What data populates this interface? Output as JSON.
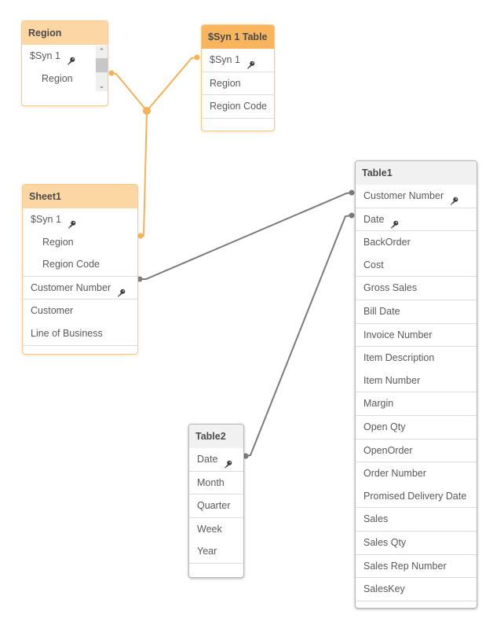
{
  "colors": {
    "synthetic_link": "#f6b154",
    "link": "#7a7a7a",
    "header_light_orange": "#fdd7a3",
    "header_orange": "#f8b55e",
    "header_gray": "#f1f1f1"
  },
  "tables": {
    "region": {
      "title": "Region",
      "groups": [
        [
          {
            "label": "$Syn 1",
            "key": true
          },
          {
            "label": "Region",
            "indent": true
          }
        ]
      ],
      "scrollbar": {
        "up_icon": "chevron-up-icon",
        "down_icon": "chevron-down-icon"
      }
    },
    "syn1table": {
      "title": "$Syn 1 Table",
      "groups": [
        [
          {
            "label": "$Syn 1",
            "key": true
          }
        ],
        [
          {
            "label": "Region"
          }
        ],
        [
          {
            "label": "Region Code"
          }
        ]
      ]
    },
    "sheet1": {
      "title": "Sheet1",
      "groups": [
        [
          {
            "label": "$Syn 1",
            "key": true
          },
          {
            "label": "Region",
            "indent": true
          },
          {
            "label": "Region Code",
            "indent": true
          }
        ],
        [
          {
            "label": "Customer Number",
            "key": true
          }
        ],
        [
          {
            "label": "Customer"
          },
          {
            "label": "Line of Business"
          }
        ]
      ]
    },
    "table1": {
      "title": "Table1",
      "groups": [
        [
          {
            "label": "Customer Number",
            "key": true
          }
        ],
        [
          {
            "label": "Date",
            "key": true
          }
        ],
        [
          {
            "label": "BackOrder"
          },
          {
            "label": "Cost"
          }
        ],
        [
          {
            "label": "Gross Sales"
          }
        ],
        [
          {
            "label": "Bill Date"
          }
        ],
        [
          {
            "label": "Invoice Number"
          }
        ],
        [
          {
            "label": "Item Description"
          },
          {
            "label": "Item Number"
          }
        ],
        [
          {
            "label": "Margin"
          }
        ],
        [
          {
            "label": "Open Qty"
          }
        ],
        [
          {
            "label": "OpenOrder"
          }
        ],
        [
          {
            "label": "Order Number"
          },
          {
            "label": "Promised Delivery Date"
          }
        ],
        [
          {
            "label": "Sales"
          }
        ],
        [
          {
            "label": "Sales Qty"
          }
        ],
        [
          {
            "label": "Sales Rep Number"
          }
        ],
        [
          {
            "label": "SalesKey"
          }
        ]
      ]
    },
    "table2": {
      "title": "Table2",
      "groups": [
        [
          {
            "label": "Date",
            "key": true
          }
        ],
        [
          {
            "label": "Month"
          }
        ],
        [
          {
            "label": "Quarter"
          }
        ],
        [
          {
            "label": "Week"
          },
          {
            "label": "Year"
          }
        ]
      ]
    }
  },
  "links": [
    {
      "kind": "synthetic",
      "from": "Region.$Syn 1",
      "to": "$Syn 1 Table.$Syn 1"
    },
    {
      "kind": "synthetic",
      "from": "Sheet1.$Syn 1",
      "to": "$Syn 1 Table.$Syn 1"
    },
    {
      "kind": "key",
      "from": "Sheet1.Customer Number",
      "to": "Table1.Customer Number"
    },
    {
      "kind": "key",
      "from": "Table2.Date",
      "to": "Table1.Date"
    }
  ]
}
